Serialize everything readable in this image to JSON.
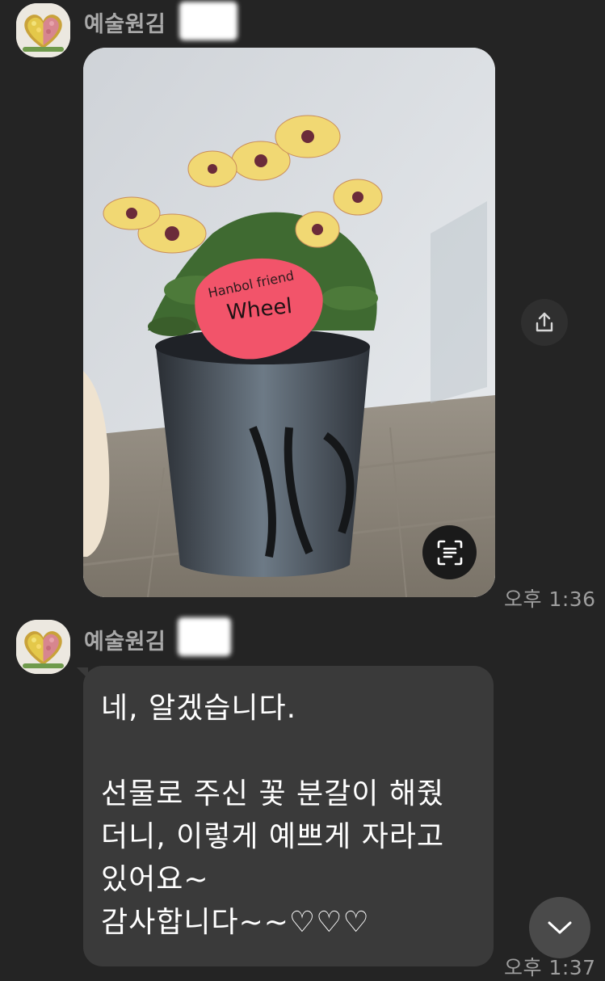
{
  "messages": [
    {
      "sender": "예술원김",
      "type": "image",
      "image": {
        "tag_line1": "Hanbol friend",
        "tag_line2": "Wheel"
      },
      "time": "오후 1:36",
      "share_icon": "share-icon",
      "scan_icon": "text-scan-icon"
    },
    {
      "sender": "예술원김",
      "type": "text",
      "lines": [
        "네, 알겠습니다.",
        "",
        "선물로 주신 꽃 분갈이 해줬",
        "더니, 이렇게 예쁘게 자라고",
        "있어요~",
        "감사합니다~~♡♡♡"
      ],
      "time": "오후 1:37"
    }
  ],
  "scroll_down_icon": "chevron-down-icon",
  "colors": {
    "background": "#242424",
    "bubble": "#3a3a3a",
    "sender_text": "#a9a9a9",
    "time_text": "#9e9e9e",
    "bubble_text": "#ffffff"
  }
}
